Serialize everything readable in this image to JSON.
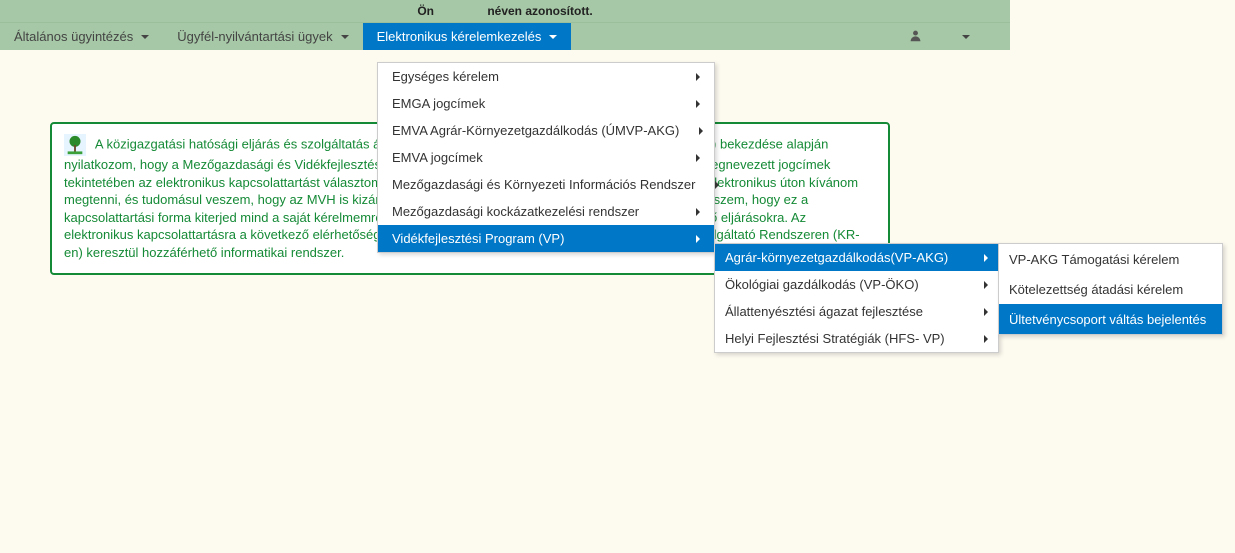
{
  "topbar": {
    "prefix": "Ön",
    "suffix": "néven azonosított."
  },
  "nav": {
    "items": [
      {
        "label": "Általános ügyintézés"
      },
      {
        "label": "Ügyfél-nyilvántartási ügyek"
      },
      {
        "label": "Elektronikus kérelemkezelés"
      }
    ]
  },
  "card": {
    "text": "A közigazgatási hatósági eljárás és szolgáltatás általános szabályairól szóló 2004. évi CXL. törvény 28/B (4) bekezdése alapján nyilatkozom, hogy a Mezőgazdasági és Vidékfejlesztési Hivatallal (MVH-val), a jelen nyilatkozat mellékletében megnevezett jogcímek tekintetében az elektronikus kapcsolattartást választom. Nyilatkozom, hogy az MVH-hoz az érintett jogcímekkel elektronikus úton kívánom megtenni, és tudomásul veszem, hogy az MVH is kizárólag elektronikus úton juttatja el az iratokat. Tudomásul veszem, hogy ez a kapcsolattartási forma kiterjed mind a saját kérelmemre indult, mind pedig a hivatalból induló, e jogcímhez történő eljárásokra. Az elektronikus kapcsolattartásra a következő elérhetőséget jelentem be: az Ügyfélkapun/Központi Elektronikus Szolgáltató Rendszeren (KR-en) keresztül hozzáférhető informatikai rendszer."
  },
  "menu1": {
    "items": [
      {
        "label": "Egységes kérelem",
        "arrow": true
      },
      {
        "label": "EMGA jogcímek",
        "arrow": true
      },
      {
        "label": "EMVA Agrár-Környezetgazdálkodás (ÚMVP-AKG)",
        "arrow": true
      },
      {
        "label": "EMVA jogcímek",
        "arrow": true
      },
      {
        "label": "Mezőgazdasági és Környezeti Információs Rendszer",
        "arrow": true
      },
      {
        "label": "Mezőgazdasági kockázatkezelési rendszer",
        "arrow": true
      },
      {
        "label": "Vidékfejlesztési Program (VP)",
        "arrow": true,
        "active": true
      }
    ]
  },
  "menu2": {
    "items": [
      {
        "label": "Agrár-környezetgazdálkodás(VP-AKG)",
        "arrow": true,
        "active": true
      },
      {
        "label": "Ökológiai gazdálkodás (VP-ÖKO)",
        "arrow": true
      },
      {
        "label": "Állattenyésztési ágazat fejlesztése",
        "arrow": true
      },
      {
        "label": "Helyi Fejlesztési Stratégiák (HFS- VP)",
        "arrow": true
      }
    ]
  },
  "menu3": {
    "items": [
      {
        "label": "VP-AKG Támogatási kérelem"
      },
      {
        "label": "Kötelezettség átadási kérelem"
      },
      {
        "label": "Ültetvénycsoport váltás bejelentés",
        "active": true
      }
    ]
  }
}
